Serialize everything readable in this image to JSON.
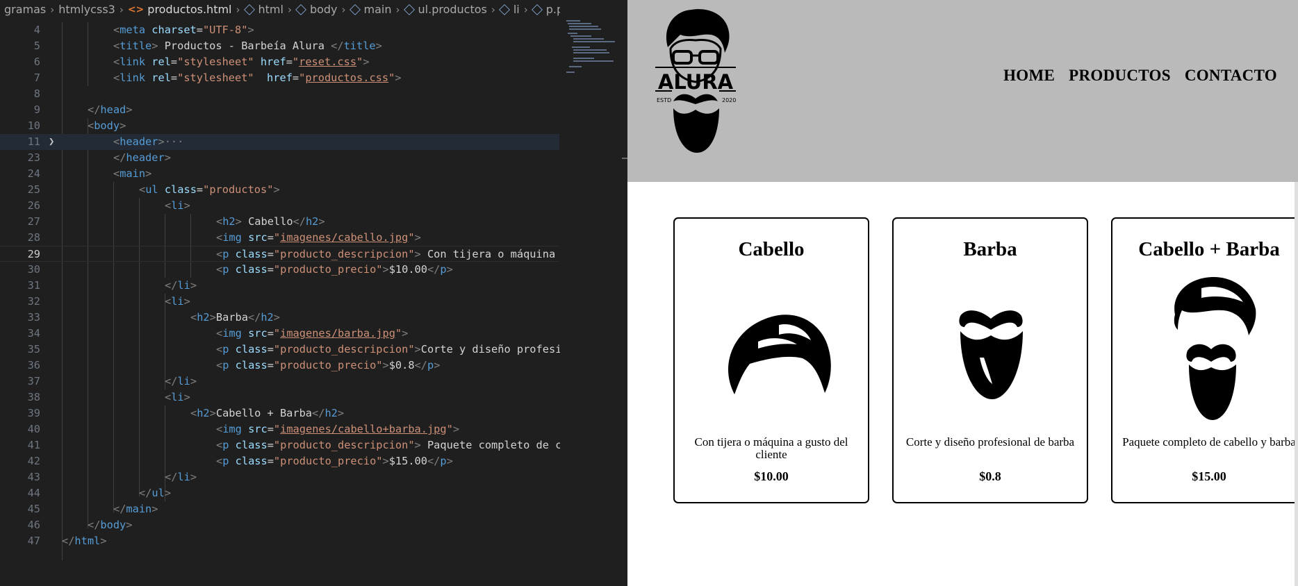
{
  "breadcrumb": {
    "items": [
      "gramas",
      "htmlycss3",
      "productos.html",
      "html",
      "body",
      "main",
      "ul.productos",
      "li",
      "p.producto_descripcion"
    ]
  },
  "code": {
    "l4": {
      "num": "4",
      "a": "<",
      "b": "meta",
      "c": " charset",
      "d": "=",
      "e": "\"UTF-8\"",
      "f": ">"
    },
    "l5": {
      "num": "5",
      "a": "<",
      "b": "title",
      "c": ">",
      "d": " Productos - Barbeía Alura ",
      "e": "</",
      "f": "title",
      "g": ">"
    },
    "l6": {
      "num": "6",
      "a": "<",
      "b": "link",
      "c": " rel",
      "d": "=",
      "e": "\"stylesheet\"",
      "f": " href",
      "g": "=",
      "h": "\"",
      "i": "reset.css",
      "j": "\"",
      "k": ">"
    },
    "l7": {
      "num": "7",
      "a": "<",
      "b": "link",
      "c": " rel",
      "d": "=",
      "e": "\"stylesheet\"",
      "f": "  href",
      "g": "=",
      "h": "\"",
      "i": "productos.css",
      "j": "\"",
      "k": ">"
    },
    "l8": {
      "num": "8"
    },
    "l9": {
      "num": "9",
      "a": "</",
      "b": "head",
      "c": ">"
    },
    "l10": {
      "num": "10",
      "a": "<",
      "b": "body",
      "c": ">"
    },
    "l11": {
      "num": "11",
      "a": "<",
      "b": "header",
      "c": ">",
      "d": "···"
    },
    "l23": {
      "num": "23",
      "a": "</",
      "b": "header",
      "c": ">"
    },
    "l24": {
      "num": "24",
      "a": "<",
      "b": "main",
      "c": ">"
    },
    "l25": {
      "num": "25",
      "a": "<",
      "b": "ul",
      "c": " class",
      "d": "=",
      "e": "\"productos\"",
      "f": ">"
    },
    "l26": {
      "num": "26",
      "a": "<",
      "b": "li",
      "c": ">"
    },
    "l27": {
      "num": "27",
      "a": "<",
      "b": "h2",
      "c": ">",
      "d": " Cabello",
      "e": "</",
      "f": "h2",
      "g": ">"
    },
    "l28": {
      "num": "28",
      "a": "<",
      "b": "img",
      "c": " src",
      "d": "=",
      "e": "\"",
      "f": "imagenes/cabello.jpg",
      "g": "\"",
      "h": ">"
    },
    "l29": {
      "num": "29",
      "a": "<",
      "b": "p",
      "c": " class",
      "d": "=",
      "e": "\"producto_descripcion\"",
      "f": ">",
      "g": " Con tijera o máquina"
    },
    "l30": {
      "num": "30",
      "a": "<",
      "b": "p",
      "c": " class",
      "d": "=",
      "e": "\"producto_precio\"",
      "f": ">",
      "g": "$10.00",
      "h": "</",
      "i": "p",
      "j": ">"
    },
    "l31": {
      "num": "31",
      "a": "</",
      "b": "li",
      "c": ">"
    },
    "l32": {
      "num": "32",
      "a": "<",
      "b": "li",
      "c": ">"
    },
    "l33": {
      "num": "33",
      "a": "<",
      "b": "h2",
      "c": ">",
      "d": "Barba",
      "e": "</",
      "f": "h2",
      "g": ">"
    },
    "l34": {
      "num": "34",
      "a": "<",
      "b": "img",
      "c": " src",
      "d": "=",
      "e": "\"",
      "f": "imagenes/barba.jpg",
      "g": "\"",
      "h": ">"
    },
    "l35": {
      "num": "35",
      "a": "<",
      "b": "p",
      "c": " class",
      "d": "=",
      "e": "\"producto_descripcion\"",
      "f": ">",
      "g": "Corte y diseño profesi"
    },
    "l36": {
      "num": "36",
      "a": "<",
      "b": "p",
      "c": " class",
      "d": "=",
      "e": "\"producto_precio\"",
      "f": ">",
      "g": "$0.8",
      "h": "</",
      "i": "p",
      "j": ">"
    },
    "l37": {
      "num": "37",
      "a": "</",
      "b": "li",
      "c": ">"
    },
    "l38": {
      "num": "38",
      "a": "<",
      "b": "li",
      "c": ">"
    },
    "l39": {
      "num": "39",
      "a": "<",
      "b": "h2",
      "c": ">",
      "d": "Cabello + Barba",
      "e": "</",
      "f": "h2",
      "g": ">"
    },
    "l40": {
      "num": "40",
      "a": "<",
      "b": "img",
      "c": " src",
      "d": "=",
      "e": "\"",
      "f": "imagenes/cabello+barba.jpg",
      "g": "\"",
      "h": ">"
    },
    "l41": {
      "num": "41",
      "a": "<",
      "b": "p",
      "c": " class",
      "d": "=",
      "e": "\"producto_descripcion\"",
      "f": ">",
      "g": " Paquete completo de c"
    },
    "l42": {
      "num": "42",
      "a": "<",
      "b": "p",
      "c": " class",
      "d": "=",
      "e": "\"producto_precio\"",
      "f": ">",
      "g": "$15.00",
      "h": "</",
      "i": "p",
      "j": ">"
    },
    "l43": {
      "num": "43",
      "a": "</",
      "b": "li",
      "c": ">"
    },
    "l44": {
      "num": "44",
      "a": "</",
      "b": "ul",
      "c": ">"
    },
    "l45": {
      "num": "45",
      "a": "</",
      "b": "main",
      "c": ">"
    },
    "l46": {
      "num": "46",
      "a": "</",
      "b": "body",
      "c": ">"
    },
    "l47": {
      "num": "47",
      "a": "</",
      "b": "html",
      "c": ">"
    }
  },
  "site": {
    "logo": {
      "brand": "ALURA",
      "estd": "ESTD",
      "year": "2020"
    },
    "nav": [
      "HOME",
      "PRODUCTOS",
      "CONTACTO"
    ],
    "products": [
      {
        "title": "Cabello",
        "image": "hair-icon",
        "description": "Con tijera o máquina a gusto del cliente",
        "price": "$10.00"
      },
      {
        "title": "Barba",
        "image": "beard-icon",
        "description": "Corte y diseño profesional de barba",
        "price": "$0.8"
      },
      {
        "title": "Cabello + Barba",
        "image": "hair-and-beard-icon",
        "description": "Paquete completo de cabello y barba",
        "price": "$15.00"
      }
    ]
  },
  "colors": {
    "editor_bg": "#1f1f1f",
    "tag": "#569cd6",
    "attribute": "#9cdcfe",
    "string": "#ce9178",
    "header_bg": "#bababa"
  }
}
